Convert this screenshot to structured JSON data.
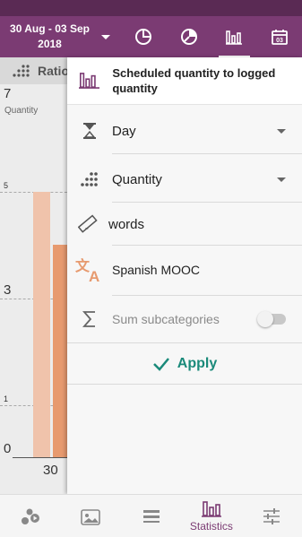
{
  "header": {
    "date_line1": "30 Aug - 03 Sep",
    "date_line2": "2018",
    "tabs": [
      {
        "icon": "pie-chart-icon"
      },
      {
        "icon": "pie-chart-split-icon"
      },
      {
        "icon": "bar-chart-icon",
        "active": true
      },
      {
        "icon": "calendar-icon",
        "day": "03"
      }
    ]
  },
  "chart": {
    "header_label": "Ratio",
    "y_max_label": "7",
    "y_unit": "Quantity",
    "tick_5": "5",
    "tick_3": "3",
    "tick_1": "1",
    "tick_0": "0",
    "x_label": "30",
    "colors": {
      "bar_light": "#f0c3ab",
      "bar_dark": "#e79a6f"
    }
  },
  "panel": {
    "title": "Scheduled quantity to logged quantity",
    "title_icon": "bar-chart-icon",
    "rows": {
      "interval": {
        "icon": "hourglass-icon",
        "value": "Day"
      },
      "measure": {
        "icon": "dots-grid-icon",
        "value": "Quantity"
      },
      "unit": {
        "icon": "ruler-icon",
        "value": "words"
      },
      "category": {
        "icon": "translate-icon",
        "value": "Spanish MOOC"
      },
      "sum": {
        "icon": "sigma-icon",
        "label": "Sum subcategories",
        "enabled": false
      }
    },
    "apply_label": "Apply",
    "apply_color": "#1a8a7a"
  },
  "bottom_nav": {
    "items": [
      {
        "icon": "activities-icon",
        "label": ""
      },
      {
        "icon": "photo-icon",
        "label": ""
      },
      {
        "icon": "list-icon",
        "label": ""
      },
      {
        "icon": "bar-chart-icon",
        "label": "Statistics",
        "active": true
      },
      {
        "icon": "sliders-icon",
        "label": ""
      }
    ]
  },
  "colors": {
    "brand": "#7b3b73",
    "brand_dark": "#5a2a54",
    "accent": "#1a8a7a"
  }
}
